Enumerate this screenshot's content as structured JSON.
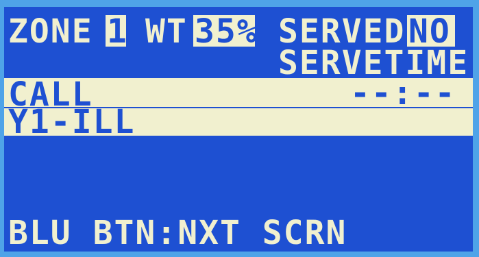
{
  "screen": {
    "row1": {
      "zone_label": "ZONE",
      "zone_value": "1",
      "wt_label": "WT",
      "wt_value": "35%",
      "served_label": "SERVED",
      "served_value": "NO"
    },
    "row2": {
      "servetime_label": "SERVETIME"
    },
    "row3": {
      "call_label": "CALL",
      "time_value": "--:--"
    },
    "row4": {
      "call_code": "Y1-ILL"
    },
    "footer": {
      "hint": "BLU BTN:NXT SCRN"
    }
  },
  "colors": {
    "lcd_background": "#1e50d2",
    "lcd_foreground": "#f1f0cf",
    "bezel": "#4fa3e8"
  }
}
